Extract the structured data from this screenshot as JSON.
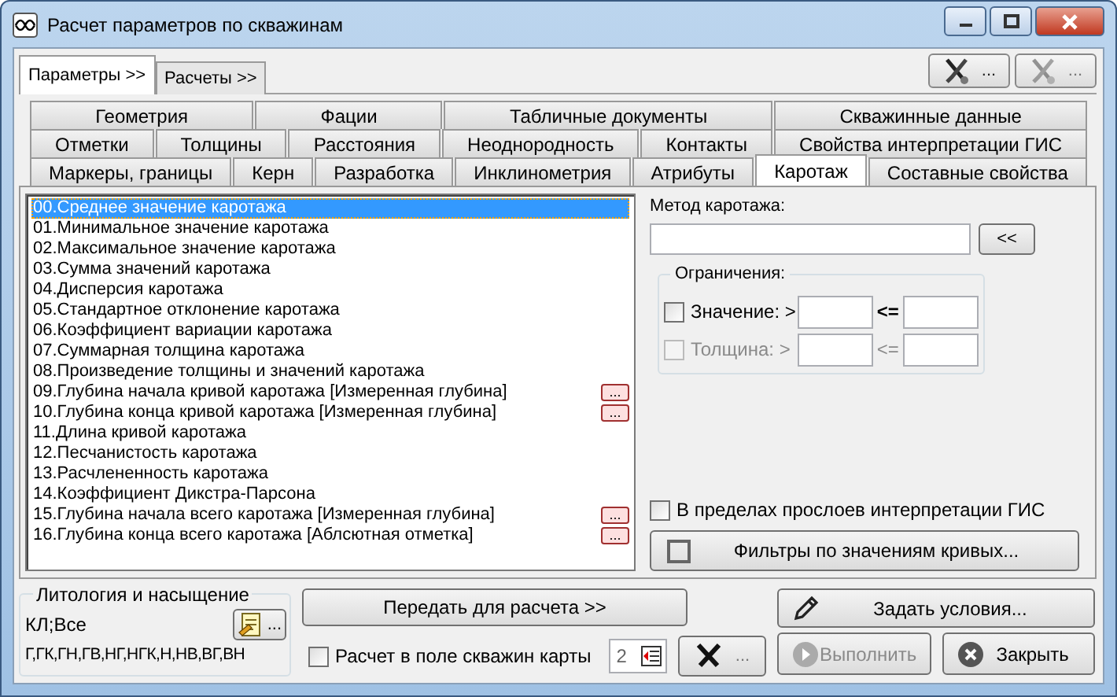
{
  "window": {
    "title": "Расчет параметров по скважинам"
  },
  "top_tabs": [
    {
      "label": "Параметры >>",
      "selected": true
    },
    {
      "label": "Расчеты >>",
      "selected": false
    }
  ],
  "tool_buttons": [
    {
      "label": "...",
      "disabled": false
    },
    {
      "label": "...",
      "disabled": true
    }
  ],
  "tab_rows": [
    [
      {
        "label": "Геометрия",
        "selected": false
      },
      {
        "label": "Фации",
        "selected": false
      },
      {
        "label": "Табличные документы",
        "selected": false
      },
      {
        "label": "Скважинные данные",
        "selected": false
      }
    ],
    [
      {
        "label": "Отметки",
        "selected": false
      },
      {
        "label": "Толщины",
        "selected": false
      },
      {
        "label": "Расстояния",
        "selected": false
      },
      {
        "label": "Неоднородность",
        "selected": false
      },
      {
        "label": "Контакты",
        "selected": false
      },
      {
        "label": "Свойства интерпретации ГИС",
        "selected": false
      }
    ],
    [
      {
        "label": "Маркеры, границы",
        "selected": false
      },
      {
        "label": "Керн",
        "selected": false
      },
      {
        "label": "Разработка",
        "selected": false
      },
      {
        "label": "Инклинометрия",
        "selected": false
      },
      {
        "label": "Атрибуты",
        "selected": false
      },
      {
        "label": "Каротаж",
        "selected": true
      },
      {
        "label": "Составные свойства",
        "selected": false
      }
    ]
  ],
  "list": [
    {
      "label": "00.Среднее значение каротажа",
      "selected": true
    },
    {
      "label": "01.Минимальное значение каротажа",
      "selected": false
    },
    {
      "label": "02.Максимальное значение каротажа",
      "selected": false
    },
    {
      "label": "03.Сумма значений каротажа",
      "selected": false
    },
    {
      "label": "04.Дисперсия каротажа",
      "selected": false
    },
    {
      "label": "05.Стандартное отклонение каротажа",
      "selected": false
    },
    {
      "label": "06.Коэффициент вариации каротажа",
      "selected": false
    },
    {
      "label": "07.Суммарная толщина каротажа",
      "selected": false
    },
    {
      "label": "08.Произведение толщины и значений каротажа",
      "selected": false
    },
    {
      "label": "09.Глубина начала кривой каротажа [Измеренная глубина]",
      "selected": false,
      "button": "..."
    },
    {
      "label": "10.Глубина конца кривой каротажа [Измеренная глубина]",
      "selected": false,
      "button": "..."
    },
    {
      "label": "11.Длина кривой каротажа",
      "selected": false
    },
    {
      "label": "12.Песчанистость каротажа",
      "selected": false
    },
    {
      "label": "13.Расчлененность каротажа",
      "selected": false
    },
    {
      "label": "14.Коэффициент Дикстра-Парсона",
      "selected": false
    },
    {
      "label": "15.Глубина начала всего каротажа [Измеренная глубина]",
      "selected": false,
      "button": "..."
    },
    {
      "label": "16.Глубина конца всего каротажа [Аблсютная отметка]",
      "selected": false,
      "button": "..."
    }
  ],
  "method": {
    "label": "Метод каротажа:",
    "button": "<<"
  },
  "limits": {
    "title": "Ограничения:",
    "rows": [
      {
        "label": "Значение: >",
        "checked": false,
        "disabled": false,
        "operator": "<="
      },
      {
        "label": "Толщина: >",
        "checked": false,
        "disabled": true,
        "operator": "<="
      }
    ]
  },
  "gis_checkbox": {
    "label": "В пределах прослоев интерпретации ГИС",
    "checked": false
  },
  "filters_button": {
    "label": "Фильтры по значениям кривых...",
    "checked": false
  },
  "lithology": {
    "title": "Литология и насыщение",
    "line_1": "КЛ;Все",
    "line_2": "Г,ГК,ГН,ГВ,НГ,НГК,Н,НВ,ВГ,ВН",
    "button": "..."
  },
  "transfer_button": {
    "label": "Передать для расчета >>"
  },
  "map_checkbox": {
    "label": "Расчет в поле скважин карты",
    "checked": false
  },
  "spin_value": "2",
  "settings_button": {
    "label": "...",
    "disabled": true
  },
  "conditions_button": {
    "label": "Задать условия..."
  },
  "run_button": {
    "label": "Выполнить",
    "disabled": true
  },
  "close_button": {
    "label": "Закрыть"
  }
}
